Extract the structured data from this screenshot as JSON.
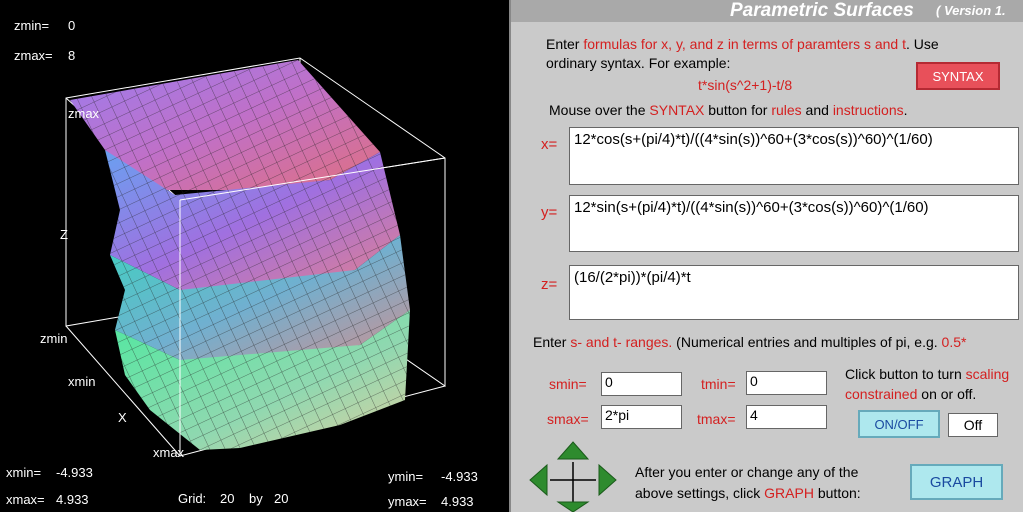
{
  "graph": {
    "zmin_label": "zmin=",
    "zmin_value": "0",
    "zmax_label": "zmax=",
    "zmax_value": "8",
    "box_zmax": "zmax",
    "box_z": "Z",
    "box_zmin": "zmin",
    "box_xmin": "xmin",
    "box_x": "X",
    "box_xmax": "xmax",
    "xmin_label": "xmin=",
    "xmin_value": "-4.933",
    "xmax_label": "xmax=",
    "xmax_value": "4.933",
    "grid_label": "Grid:",
    "grid_a": "20",
    "grid_by": "by",
    "grid_b": "20",
    "ymin_label": "ymin=",
    "ymin_value": "-4.933",
    "ymax_label": "ymax=",
    "ymax_value": "4.933"
  },
  "header": {
    "title": "Parametric Surfaces",
    "version": "( Version 1."
  },
  "instructions": {
    "l1a": "Enter ",
    "l1b": "formulas for x, y, and z in terms of paramters s and t",
    "l1c": ". Use",
    "l2": "ordinary syntax. For example:",
    "example": "t*sin(s^2+1)-t/8",
    "l3a": "Mouse over the ",
    "l3b": "SYNTAX",
    "l3c": " button for ",
    "l3d": "rules",
    "l3e": " and ",
    "l3f": "instructions",
    "l3g": "."
  },
  "buttons": {
    "syntax": "SYNTAX",
    "onoff": "ON/OFF",
    "off": "Off",
    "graph": "GRAPH"
  },
  "equations": {
    "x_label": "x=",
    "x_value": "12*cos(s+(pi/4)*t)/((4*sin(s))^60+(3*cos(s))^60)^(1/60)",
    "y_label": "y=",
    "y_value": "12*sin(s+(pi/4)*t)/((4*sin(s))^60+(3*cos(s))^60)^(1/60)",
    "z_label": "z=",
    "z_value": "(16/(2*pi))*(pi/4)*t"
  },
  "ranges": {
    "intro_a": "Enter ",
    "intro_b": "s- and  t- ranges.",
    "intro_c": " (Numerical entries and multiples of pi, e.g. ",
    "intro_d": "0.5*",
    "smin_label": "smin=",
    "smin_value": "0",
    "smax_label": "smax=",
    "smax_value": "2*pi",
    "tmin_label": "tmin=",
    "tmin_value": "0",
    "tmax_label": "tmax=",
    "tmax_value": "4",
    "scale_a": "Click button to turn ",
    "scale_b": "scaling",
    "scale_c": "constrained",
    "scale_d": " on or off."
  },
  "footer": {
    "note_a": "After you enter or change any of  the",
    "note_b": "above settings, click ",
    "note_c": "GRAPH",
    "note_d": " button:"
  }
}
